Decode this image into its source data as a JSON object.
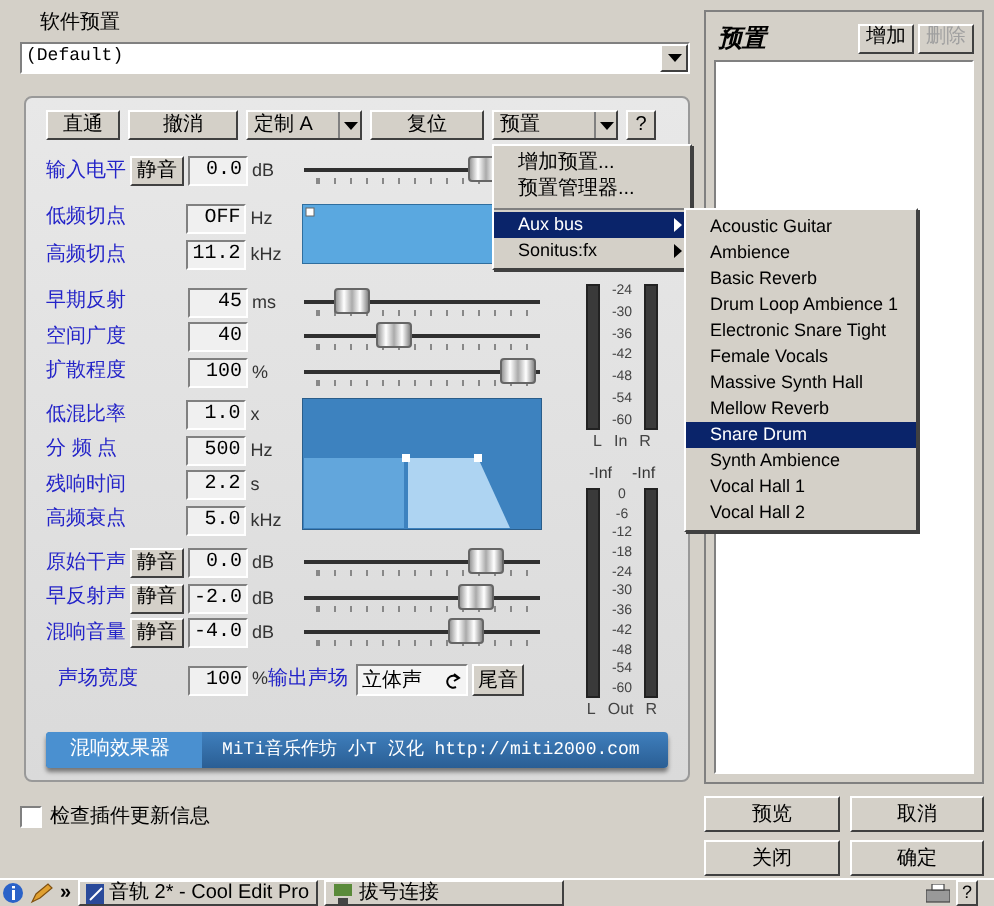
{
  "preset_label": "软件预置",
  "preset_value": "(Default)",
  "toolbar": [
    {
      "label": "直通",
      "kind": "button"
    },
    {
      "label": "撤消",
      "kind": "button"
    },
    {
      "label": "定制 A",
      "kind": "dropdown"
    },
    {
      "label": "复位",
      "kind": "button"
    },
    {
      "label": "预置",
      "kind": "dropdown"
    },
    {
      "label": "?",
      "kind": "button"
    }
  ],
  "input_row": {
    "label": "输入电平",
    "mute": "静音",
    "value": "0.0",
    "unit": "dB",
    "level": 0.82
  },
  "filter_rows": [
    {
      "label": "低频切点",
      "value": "OFF",
      "unit": "Hz"
    },
    {
      "label": "高频切点",
      "value": "11.2",
      "unit": "kHz"
    }
  ],
  "reflection_rows": [
    {
      "label": "早期反射",
      "value": "45",
      "unit": "ms",
      "level": 0.15
    },
    {
      "label": "空间广度",
      "value": "40",
      "level": 0.36
    },
    {
      "label": "扩散程度",
      "value": "100",
      "unit": "%",
      "level": 0.98
    }
  ],
  "reverb_rows": [
    {
      "label": "低混比率",
      "value": "1.0",
      "unit": "x"
    },
    {
      "label": "分 频 点",
      "value": "500",
      "unit": "Hz"
    },
    {
      "label": "残响时间",
      "value": "2.2",
      "unit": "s"
    },
    {
      "label": "高频衰点",
      "value": "5.0",
      "unit": "kHz"
    }
  ],
  "mix_rows": [
    {
      "label": "原始干声",
      "mute": "静音",
      "value": "0.0",
      "unit": "dB",
      "level": 0.82
    },
    {
      "label": "早反射声",
      "mute": "静音",
      "value": "-2.0",
      "unit": "dB",
      "level": 0.77
    },
    {
      "label": "混响音量",
      "mute": "静音",
      "value": "-4.0",
      "unit": "dB",
      "level": 0.72
    }
  ],
  "width_row": {
    "label": "声场宽度",
    "value": "100",
    "unit": "%",
    "output_label": "输出声场",
    "output_value": "立体声",
    "tail_button": "尾音"
  },
  "meters": {
    "in": {
      "scale": [
        "-24",
        "-30",
        "-36",
        "-42",
        "-48",
        "-54",
        "-60"
      ],
      "left": "L",
      "middle": "In",
      "right": "R"
    },
    "peaks": [
      "-Inf",
      "-Inf"
    ],
    "out": {
      "scale": [
        "0",
        "-6",
        "-12",
        "-18",
        "-24",
        "-30",
        "-36",
        "-42",
        "-48",
        "-54",
        "-60"
      ],
      "left": "L",
      "middle": "Out",
      "right": "R"
    }
  },
  "banner": {
    "tab": "混响效果器",
    "credit": "MiTi音乐作坊 小T 汉化 http://miti2000.com"
  },
  "check_updates": {
    "label": "检查插件更新信息",
    "checked": false
  },
  "preset_panel": {
    "title": "预置",
    "buttons": [
      {
        "label": "增加",
        "disabled": false
      },
      {
        "label": "删除",
        "disabled": true
      }
    ]
  },
  "dialog_buttons": [
    "预览",
    "取消",
    "关闭",
    "确定"
  ],
  "presets_menu": [
    {
      "label": "增加预置...",
      "kind": "item",
      "selected": false
    },
    {
      "label": "预置管理器...",
      "kind": "item",
      "selected": false
    },
    {
      "kind": "separator"
    },
    {
      "label": "Aux bus",
      "kind": "submenu",
      "selected": true
    },
    {
      "label": "Sonitus:fx",
      "kind": "submenu",
      "selected": false
    }
  ],
  "submenu": [
    {
      "label": "Acoustic Guitar",
      "selected": false
    },
    {
      "label": "Ambience",
      "selected": false
    },
    {
      "label": "Basic Reverb",
      "selected": false
    },
    {
      "label": "Drum Loop Ambience 1",
      "selected": false
    },
    {
      "label": "Electronic Snare Tight",
      "selected": false
    },
    {
      "label": "Female Vocals",
      "selected": false
    },
    {
      "label": "Massive Synth Hall",
      "selected": false
    },
    {
      "label": "Mellow Reverb",
      "selected": false
    },
    {
      "label": "Snare Drum",
      "selected": true
    },
    {
      "label": "Synth Ambience",
      "selected": false
    },
    {
      "label": "Vocal Hall 1",
      "selected": false
    },
    {
      "label": "Vocal Hall 2",
      "selected": false
    }
  ],
  "taskbar": {
    "more": "»",
    "tasks": [
      {
        "label": "音轨 2* - Cool Edit Pro",
        "kind": "app"
      },
      {
        "label": "拔号连接",
        "kind": "network"
      }
    ],
    "help": "?"
  }
}
